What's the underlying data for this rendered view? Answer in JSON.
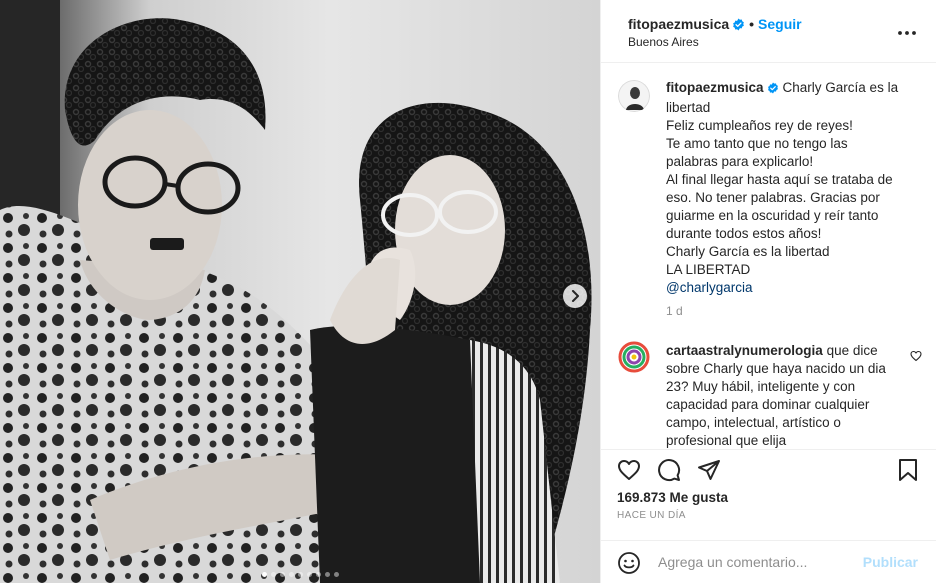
{
  "post": {
    "username": "fitopaezmusica",
    "follow_label": "Seguir",
    "separator": "•",
    "location": "Buenos Aires",
    "more_icon": "more-options-icon",
    "verified_icon": "verified-badge-icon",
    "carousel": {
      "slide_count": 9,
      "active_index": 0,
      "next_icon": "chevron-right-icon"
    }
  },
  "caption": {
    "username": "fitopaezmusica",
    "first_text": "Charly García es la",
    "lines": [
      "libertad",
      "Feliz cumpleaños rey de reyes!",
      "Te amo tanto que no tengo las",
      "palabras para explicarlo!",
      "Al final llegar hasta aquí se trataba de",
      "eso. No tener palabras. Gracias por",
      "guiarme en la oscuridad y reír tanto",
      "durante todos estos años!",
      "Charly García es la libertad",
      "LA LIBERTAD"
    ],
    "mention": "@charlygarcia",
    "time_ago": "1 d"
  },
  "comment": {
    "username": "cartaastralynumerologia",
    "first_text": "que dice",
    "lines": [
      "sobre Charly que haya nacido un dia",
      "23? Muy hábil, inteligente y con",
      "capacidad para dominar cualquier",
      "campo, intelectual, artístico o",
      "profesional que elija"
    ],
    "like_icon": "heart-outline-icon"
  },
  "actions": {
    "icons": [
      "heart-icon",
      "comment-icon",
      "share-icon",
      "bookmark-icon"
    ],
    "likes": "169.873 Me gusta",
    "posted": "HACE UN DÍA"
  },
  "composer": {
    "emoji_icon": "emoji-icon",
    "placeholder": "Agrega un comentario...",
    "publish_label": "Publicar"
  },
  "colors": {
    "link_blue": "#0095f6",
    "publish_disabled": "#b2dffc",
    "mention": "#00376b",
    "muted": "#8e8e8e",
    "text": "#262626"
  }
}
